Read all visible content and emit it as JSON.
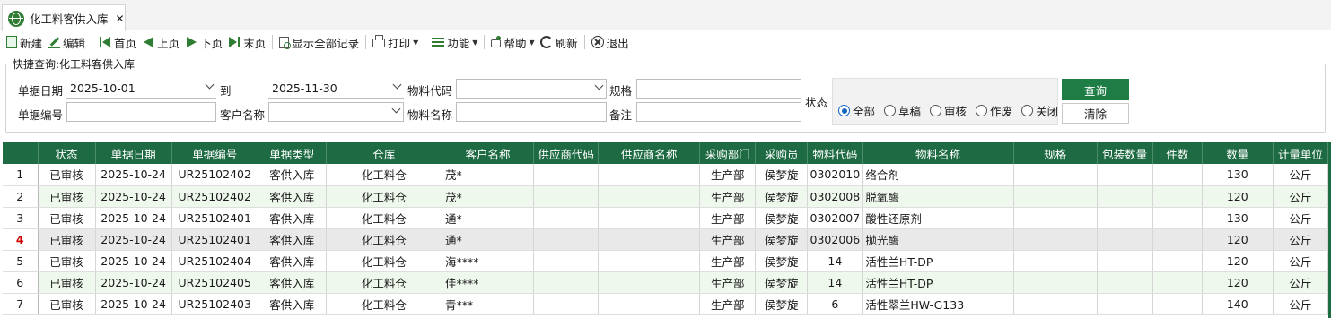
{
  "tab": {
    "title": "化工料客供入库",
    "close": "✕"
  },
  "toolbar": {
    "new": "新建",
    "edit": "编辑",
    "first": "首页",
    "prev": "上页",
    "next": "下页",
    "last": "末页",
    "show_all": "显示全部记录",
    "print": "打印",
    "function": "功能",
    "help": "帮助",
    "refresh": "刷新",
    "exit": "退出"
  },
  "quick_search": {
    "title": "快捷查询:化工料客供入库",
    "date_label": "单据日期",
    "date_from": "2025-10-01",
    "to_label": "到",
    "date_to": "2025-11-30",
    "material_code_label": "物料代码",
    "material_code": "",
    "spec_label": "规格",
    "spec": "",
    "doc_no_label": "单据编号",
    "doc_no": "",
    "customer_label": "客户名称",
    "customer": "",
    "material_name_label": "物料名称",
    "material_name": "",
    "remark_label": "备注",
    "remark": "",
    "status_label": "状态",
    "status_options": [
      "全部",
      "草稿",
      "审核",
      "作废",
      "关闭"
    ],
    "status_selected": "全部",
    "query_button": "查询",
    "clear_button": "清除"
  },
  "grid": {
    "columns": [
      "",
      "状态",
      "单据日期",
      "单据编号",
      "单据类型",
      "仓库",
      "客户名称",
      "供应商代码",
      "供应商名称",
      "采购部门",
      "采购员",
      "物料代码",
      "物料名称",
      "规格",
      "包装数量",
      "件数",
      "数量",
      "计量单位"
    ],
    "rows": [
      [
        "1",
        "已审核",
        "2025-10-24",
        "UR25102402",
        "客供入库",
        "化工料仓",
        "茂*",
        "",
        "",
        "生产部",
        "侯梦旋",
        "0302010",
        "络合剂",
        "",
        "",
        "",
        "130",
        "公斤"
      ],
      [
        "2",
        "已审核",
        "2025-10-24",
        "UR25102402",
        "客供入库",
        "化工料仓",
        "茂*",
        "",
        "",
        "生产部",
        "侯梦旋",
        "0302008",
        "脱氧酶",
        "",
        "",
        "",
        "120",
        "公斤"
      ],
      [
        "3",
        "已审核",
        "2025-10-24",
        "UR25102401",
        "客供入库",
        "化工料仓",
        "通*",
        "",
        "",
        "生产部",
        "侯梦旋",
        "0302007",
        "酸性还原剂",
        "",
        "",
        "",
        "130",
        "公斤"
      ],
      [
        "4",
        "已审核",
        "2025-10-24",
        "UR25102401",
        "客供入库",
        "化工料仓",
        "通*",
        "",
        "",
        "生产部",
        "侯梦旋",
        "0302006",
        "抛光酶",
        "",
        "",
        "",
        "120",
        "公斤"
      ],
      [
        "5",
        "已审核",
        "2025-10-24",
        "UR25102404",
        "客供入库",
        "化工料仓",
        "海****",
        "",
        "",
        "生产部",
        "侯梦旋",
        "14",
        "活性兰HT-DP",
        "",
        "",
        "",
        "120",
        "公斤"
      ],
      [
        "6",
        "已审核",
        "2025-10-24",
        "UR25102405",
        "客供入库",
        "化工料仓",
        "佳****",
        "",
        "",
        "生产部",
        "侯梦旋",
        "14",
        "活性兰HT-DP",
        "",
        "",
        "",
        "120",
        "公斤"
      ],
      [
        "7",
        "已审核",
        "2025-10-24",
        "UR25102403",
        "客供入库",
        "化工料仓",
        "青***",
        "",
        "",
        "生产部",
        "侯梦旋",
        "6",
        "活性翠兰HW-G133",
        "",
        "",
        "",
        "140",
        "公斤"
      ]
    ],
    "selected_row": "4"
  }
}
